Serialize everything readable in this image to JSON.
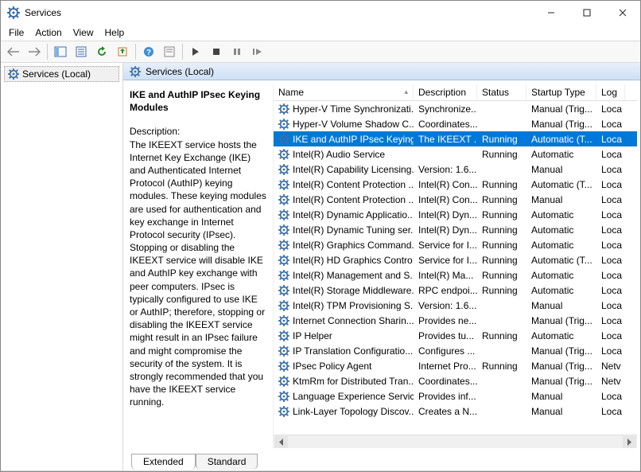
{
  "window": {
    "title": "Services"
  },
  "menu": {
    "file": "File",
    "action": "Action",
    "view": "View",
    "help": "Help"
  },
  "tree": {
    "root": "Services (Local)"
  },
  "pane": {
    "header": "Services (Local)"
  },
  "detail": {
    "title": "IKE and AuthIP IPsec Keying Modules",
    "desc_label": "Description:",
    "desc_text": "The IKEEXT service hosts the Internet Key Exchange (IKE) and Authenticated Internet Protocol (AuthIP) keying modules. These keying modules are used for authentication and key exchange in Internet Protocol security (IPsec). Stopping or disabling the IKEEXT service will disable IKE and AuthIP key exchange with peer computers. IPsec is typically configured to use IKE or AuthIP; therefore, stopping or disabling the IKEEXT service might result in an IPsec failure and might compromise the security of the system. It is strongly recommended that you have the IKEEXT service running."
  },
  "columns": {
    "name": "Name",
    "description": "Description",
    "status": "Status",
    "startup": "Startup Type",
    "logon": "Log"
  },
  "tabs": {
    "extended": "Extended",
    "standard": "Standard"
  },
  "services": [
    {
      "name": "Hyper-V Time Synchronizati...",
      "desc": "Synchronize...",
      "status": "",
      "startup": "Manual (Trig...",
      "logon": "Loca"
    },
    {
      "name": "Hyper-V Volume Shadow C...",
      "desc": "Coordinates...",
      "status": "",
      "startup": "Manual (Trig...",
      "logon": "Loca"
    },
    {
      "name": "IKE and AuthIP IPsec Keying...",
      "desc": "The IKEEXT ...",
      "status": "Running",
      "startup": "Automatic (T...",
      "logon": "Loca",
      "selected": true
    },
    {
      "name": "Intel(R) Audio Service",
      "desc": "",
      "status": "Running",
      "startup": "Automatic",
      "logon": "Loca"
    },
    {
      "name": "Intel(R) Capability Licensing...",
      "desc": "Version: 1.6...",
      "status": "",
      "startup": "Manual",
      "logon": "Loca"
    },
    {
      "name": "Intel(R) Content Protection ...",
      "desc": "Intel(R) Con...",
      "status": "Running",
      "startup": "Automatic (T...",
      "logon": "Loca"
    },
    {
      "name": "Intel(R) Content Protection ...",
      "desc": "Intel(R) Con...",
      "status": "Running",
      "startup": "Manual",
      "logon": "Loca"
    },
    {
      "name": "Intel(R) Dynamic Applicatio...",
      "desc": "Intel(R) Dyn...",
      "status": "Running",
      "startup": "Automatic",
      "logon": "Loca"
    },
    {
      "name": "Intel(R) Dynamic Tuning ser...",
      "desc": "Intel(R) Dyn...",
      "status": "Running",
      "startup": "Automatic",
      "logon": "Loca"
    },
    {
      "name": "Intel(R) Graphics Command...",
      "desc": "Service for I...",
      "status": "Running",
      "startup": "Automatic",
      "logon": "Loca"
    },
    {
      "name": "Intel(R) HD Graphics Contro...",
      "desc": "Service for I...",
      "status": "Running",
      "startup": "Automatic (T...",
      "logon": "Loca"
    },
    {
      "name": "Intel(R) Management and S...",
      "desc": "Intel(R) Ma...",
      "status": "Running",
      "startup": "Automatic",
      "logon": "Loca"
    },
    {
      "name": "Intel(R) Storage Middleware...",
      "desc": "RPC endpoi...",
      "status": "Running",
      "startup": "Automatic",
      "logon": "Loca"
    },
    {
      "name": "Intel(R) TPM Provisioning S...",
      "desc": "Version: 1.6...",
      "status": "",
      "startup": "Manual",
      "logon": "Loca"
    },
    {
      "name": "Internet Connection Sharin...",
      "desc": "Provides ne...",
      "status": "",
      "startup": "Manual (Trig...",
      "logon": "Loca"
    },
    {
      "name": "IP Helper",
      "desc": "Provides tu...",
      "status": "Running",
      "startup": "Automatic",
      "logon": "Loca"
    },
    {
      "name": "IP Translation Configuratio...",
      "desc": "Configures ...",
      "status": "",
      "startup": "Manual (Trig...",
      "logon": "Loca"
    },
    {
      "name": "IPsec Policy Agent",
      "desc": "Internet Pro...",
      "status": "Running",
      "startup": "Manual (Trig...",
      "logon": "Netv"
    },
    {
      "name": "KtmRm for Distributed Tran...",
      "desc": "Coordinates...",
      "status": "",
      "startup": "Manual (Trig...",
      "logon": "Netv"
    },
    {
      "name": "Language Experience Service",
      "desc": "Provides inf...",
      "status": "",
      "startup": "Manual",
      "logon": "Loca"
    },
    {
      "name": "Link-Layer Topology Discov...",
      "desc": "Creates a N...",
      "status": "",
      "startup": "Manual",
      "logon": "Loca"
    }
  ]
}
